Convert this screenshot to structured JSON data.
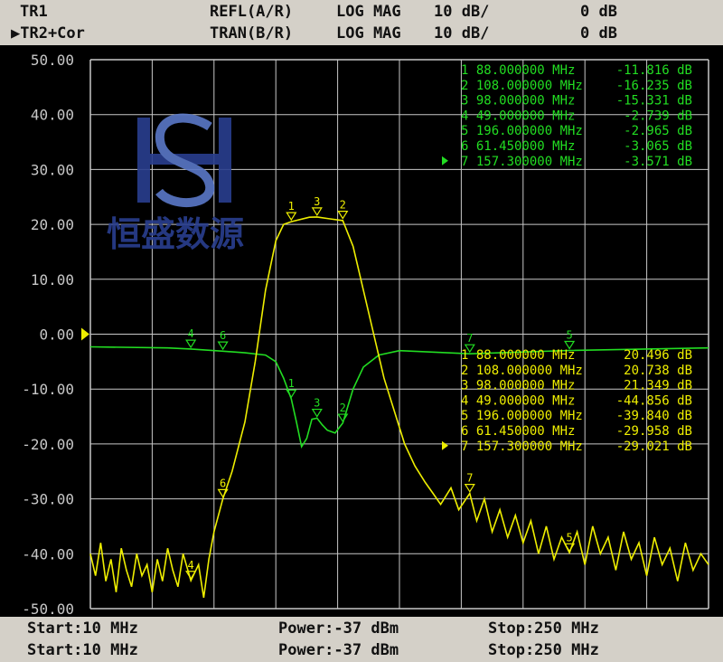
{
  "header": {
    "row1": {
      "trace": "TR1",
      "meas": "REFL(A/R)",
      "format": "LOG MAG",
      "scale": "10 dB/",
      "ref": "0 dB"
    },
    "row2": {
      "trace": "▶TR2+Cor",
      "meas": "TRAN(B/R)",
      "format": "LOG MAG",
      "scale": "10 dB/",
      "ref": "0 dB"
    }
  },
  "footer": {
    "row1": {
      "start": "Start:10 MHz",
      "power": "Power:-37 dBm",
      "stop": "Stop:250 MHz"
    },
    "row2": {
      "start": "Start:10 MHz",
      "power": "Power:-37 dBm",
      "stop": "Stop:250 MHz"
    }
  },
  "colors": {
    "refl": "#22dd22",
    "tran": "#eeee00",
    "grid": "#c8c8c8",
    "background": "#000000",
    "axis_text": "#c8c8c8"
  },
  "watermark": {
    "logo": "HS monogram",
    "text": "恒盛数源"
  },
  "chart_data": {
    "type": "line",
    "x_range_mhz": [
      10,
      250
    ],
    "ylim": [
      -50,
      50
    ],
    "y_ticks": [
      "50.00",
      "40.00",
      "30.00",
      "20.00",
      "10.00",
      "0.00",
      "-10.00",
      "-20.00",
      "-30.00",
      "-40.00",
      "-50.00"
    ],
    "series": [
      {
        "name": "REFL(A/R)",
        "color": "#22dd22",
        "points": [
          [
            10,
            -2.3
          ],
          [
            40,
            -2.5
          ],
          [
            49,
            -2.7
          ],
          [
            61.45,
            -3.1
          ],
          [
            70,
            -3.4
          ],
          [
            78,
            -3.8
          ],
          [
            82,
            -5
          ],
          [
            85,
            -8
          ],
          [
            88,
            -11.8
          ],
          [
            90,
            -16
          ],
          [
            92,
            -20.5
          ],
          [
            94,
            -19
          ],
          [
            96,
            -15.5
          ],
          [
            98,
            -15.3
          ],
          [
            100,
            -16.5
          ],
          [
            102,
            -17.5
          ],
          [
            105,
            -18
          ],
          [
            108,
            -16.2
          ],
          [
            112,
            -10
          ],
          [
            116,
            -6
          ],
          [
            122,
            -3.8
          ],
          [
            130,
            -3.0
          ],
          [
            157.3,
            -3.57
          ],
          [
            196,
            -2.97
          ],
          [
            250,
            -2.5
          ]
        ],
        "markers": [
          {
            "id": "1",
            "freq": "88.000000 MHz",
            "value": "-11.816 dB"
          },
          {
            "id": "2",
            "freq": "108.000000 MHz",
            "value": "-16.235 dB"
          },
          {
            "id": "3",
            "freq": "98.000000 MHz",
            "value": "-15.331 dB"
          },
          {
            "id": "4",
            "freq": "49.000000 MHz",
            "value": "-2.739 dB"
          },
          {
            "id": "5",
            "freq": "196.000000 MHz",
            "value": "-2.965 dB"
          },
          {
            "id": "6",
            "freq": "61.450000 MHz",
            "value": "-3.065 dB"
          },
          {
            "id": "7",
            "freq": "157.300000 MHz",
            "value": "-3.571 dB",
            "active": true
          }
        ]
      },
      {
        "name": "TRAN(B/R)",
        "color": "#eeee00",
        "points": [
          [
            10,
            -40
          ],
          [
            12,
            -44
          ],
          [
            14,
            -38
          ],
          [
            16,
            -45
          ],
          [
            18,
            -41
          ],
          [
            20,
            -47
          ],
          [
            22,
            -39
          ],
          [
            24,
            -43
          ],
          [
            26,
            -46
          ],
          [
            28,
            -40
          ],
          [
            30,
            -44
          ],
          [
            32,
            -42
          ],
          [
            34,
            -47
          ],
          [
            36,
            -41
          ],
          [
            38,
            -45
          ],
          [
            40,
            -39
          ],
          [
            42,
            -43
          ],
          [
            44,
            -46
          ],
          [
            46,
            -40
          ],
          [
            49,
            -44.9
          ],
          [
            52,
            -42
          ],
          [
            54,
            -48
          ],
          [
            56,
            -41
          ],
          [
            58,
            -36
          ],
          [
            61.45,
            -30
          ],
          [
            65,
            -25
          ],
          [
            70,
            -16
          ],
          [
            74,
            -5
          ],
          [
            78,
            8
          ],
          [
            82,
            17
          ],
          [
            85,
            20
          ],
          [
            88,
            20.5
          ],
          [
            95,
            21.3
          ],
          [
            98,
            21.35
          ],
          [
            103,
            21.0
          ],
          [
            108,
            20.7
          ],
          [
            112,
            16
          ],
          [
            116,
            8
          ],
          [
            120,
            0
          ],
          [
            124,
            -8
          ],
          [
            128,
            -14
          ],
          [
            132,
            -20
          ],
          [
            136,
            -24
          ],
          [
            140,
            -27
          ],
          [
            143,
            -29
          ],
          [
            146,
            -31
          ],
          [
            150,
            -28
          ],
          [
            153,
            -32
          ],
          [
            157.3,
            -29
          ],
          [
            160,
            -34
          ],
          [
            163,
            -30
          ],
          [
            166,
            -36
          ],
          [
            169,
            -32
          ],
          [
            172,
            -37
          ],
          [
            175,
            -33
          ],
          [
            178,
            -38
          ],
          [
            181,
            -34
          ],
          [
            184,
            -40
          ],
          [
            187,
            -35
          ],
          [
            190,
            -41
          ],
          [
            193,
            -37
          ],
          [
            196,
            -39.8
          ],
          [
            199,
            -36
          ],
          [
            202,
            -42
          ],
          [
            205,
            -35
          ],
          [
            208,
            -40
          ],
          [
            211,
            -37
          ],
          [
            214,
            -43
          ],
          [
            217,
            -36
          ],
          [
            220,
            -41
          ],
          [
            223,
            -38
          ],
          [
            226,
            -44
          ],
          [
            229,
            -37
          ],
          [
            232,
            -42
          ],
          [
            235,
            -39
          ],
          [
            238,
            -45
          ],
          [
            241,
            -38
          ],
          [
            244,
            -43
          ],
          [
            247,
            -40
          ],
          [
            250,
            -42
          ]
        ],
        "markers": [
          {
            "id": "1",
            "freq": "88.000000 MHz",
            "value": "20.496 dB"
          },
          {
            "id": "2",
            "freq": "108.000000 MHz",
            "value": "20.738 dB"
          },
          {
            "id": "3",
            "freq": "98.000000 MHz",
            "value": "21.349 dB"
          },
          {
            "id": "4",
            "freq": "49.000000 MHz",
            "value": "-44.856 dB"
          },
          {
            "id": "5",
            "freq": "196.000000 MHz",
            "value": "-39.840 dB"
          },
          {
            "id": "6",
            "freq": "61.450000 MHz",
            "value": "-29.958 dB"
          },
          {
            "id": "7",
            "freq": "157.300000 MHz",
            "value": "-29.021 dB",
            "active": true
          }
        ]
      }
    ],
    "grid": true,
    "reference_marker": "▶"
  }
}
